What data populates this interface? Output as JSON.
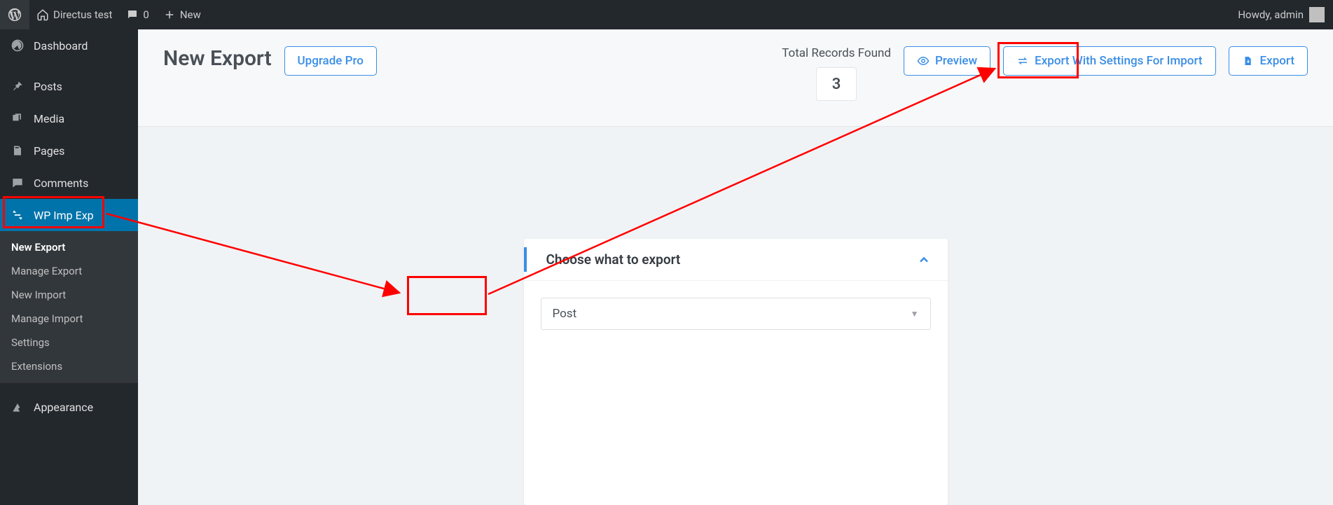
{
  "topbar": {
    "site_name": "Directus test",
    "comment_count": "0",
    "new_label": "New",
    "howdy": "Howdy, admin"
  },
  "sidebar": {
    "dashboard": "Dashboard",
    "posts": "Posts",
    "media": "Media",
    "pages": "Pages",
    "comments": "Comments",
    "wp_imp_exp": "WP Imp Exp",
    "appearance": "Appearance",
    "submenu": {
      "new_export": "New Export",
      "manage_export": "Manage Export",
      "new_import": "New Import",
      "manage_import": "Manage Import",
      "settings": "Settings",
      "extensions": "Extensions"
    }
  },
  "header": {
    "title": "New Export",
    "upgrade": "Upgrade Pro",
    "records_label": "Total Records Found",
    "records_count": "3",
    "preview": "Preview",
    "export_settings": "Export With Settings For Import",
    "export": "Export"
  },
  "panel": {
    "title": "Choose what to export",
    "select_value": "Post"
  }
}
